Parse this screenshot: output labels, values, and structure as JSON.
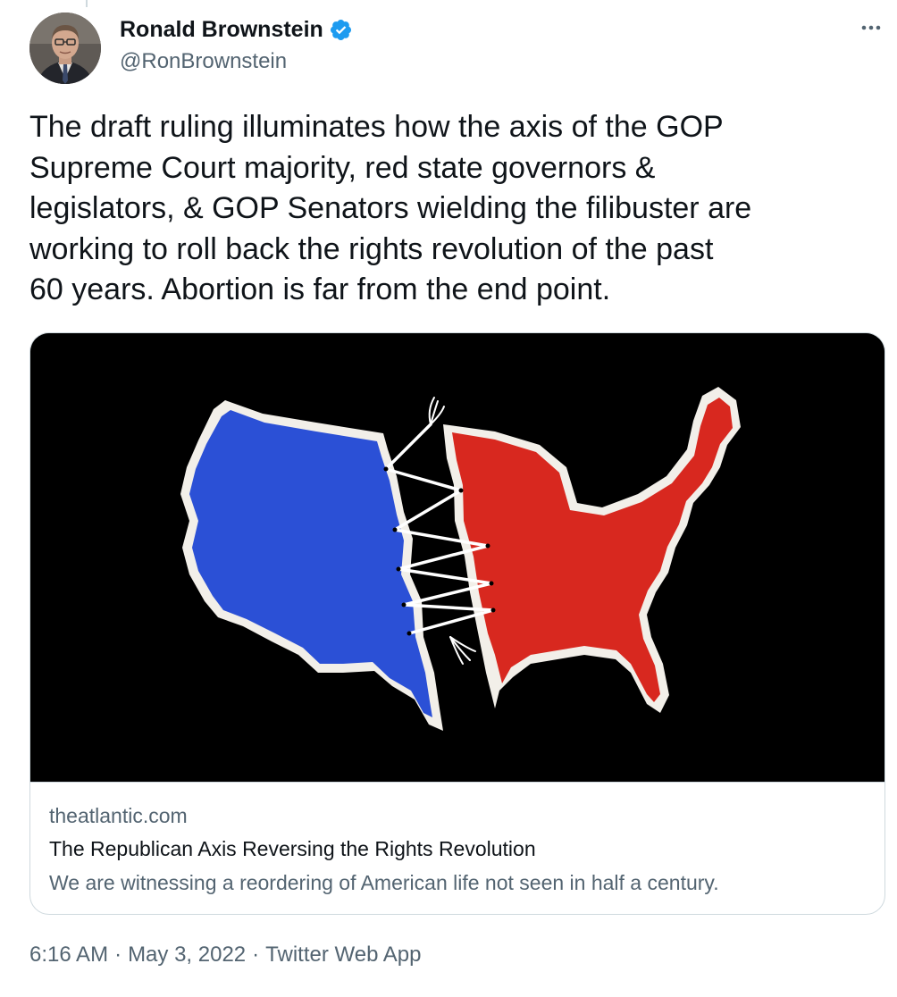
{
  "author": {
    "display_name": "Ronald Brownstein",
    "handle": "@RonBrownstein",
    "verified": true,
    "verified_color": "#1d9bf0"
  },
  "tweet": {
    "text": "The draft ruling illuminates how the axis of the GOP\nSupreme Court majority, red state governors &\nlegislators, & GOP Senators wielding the filibuster are\nworking to roll back the rights revolution of the past\n60 years. Abortion is far from the end point."
  },
  "card": {
    "domain": "theatlantic.com",
    "title": "The Republican Axis Reversing the Rights Revolution",
    "description": "We are witnessing a reordering of American life not seen in half a century.",
    "image_colors": {
      "background": "#000000",
      "left_half": "#2b50d6",
      "right_half": "#d8281f",
      "outline": "#f2efe9"
    }
  },
  "meta": {
    "time": "6:16 AM",
    "separator": "·",
    "date": "May 3, 2022",
    "source": "Twitter Web App"
  },
  "icons": {
    "verified": "verified-badge-icon",
    "more": "more-dots-icon"
  },
  "colors": {
    "text_primary": "#0f1419",
    "text_secondary": "#536471",
    "border": "#cfd9de"
  }
}
